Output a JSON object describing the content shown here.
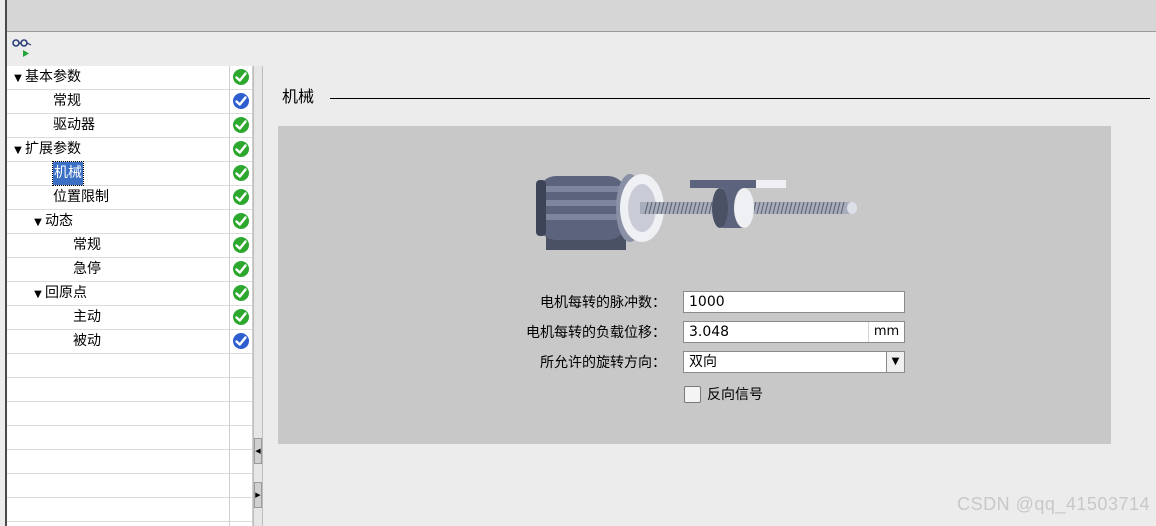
{
  "tree": {
    "items": [
      {
        "label": "基本参数",
        "indent": 0,
        "expanded": true,
        "status": "ok"
      },
      {
        "label": "常规",
        "indent": 1,
        "status": "info"
      },
      {
        "label": "驱动器",
        "indent": 1,
        "status": "ok"
      },
      {
        "label": "扩展参数",
        "indent": 0,
        "expanded": true,
        "status": "ok"
      },
      {
        "label": "机械",
        "indent": 1,
        "status": "ok",
        "selected": true
      },
      {
        "label": "位置限制",
        "indent": 1,
        "status": "ok"
      },
      {
        "label": "动态",
        "indent": 1,
        "expanded": true,
        "status": "ok"
      },
      {
        "label": "常规",
        "indent": 2,
        "status": "ok"
      },
      {
        "label": "急停",
        "indent": 2,
        "status": "ok"
      },
      {
        "label": "回原点",
        "indent": 1,
        "expanded": true,
        "status": "ok"
      },
      {
        "label": "主动",
        "indent": 2,
        "status": "ok"
      },
      {
        "label": "被动",
        "indent": 2,
        "status": "info"
      }
    ]
  },
  "section": {
    "title": "机械"
  },
  "form": {
    "pulses_label": "电机每转的脉冲数：",
    "pulses_value": "1000",
    "load_label": "电机每转的负载位移：",
    "load_value": "3.048",
    "load_unit": "mm",
    "direction_label": "所允许的旋转方向：",
    "direction_value": "双向",
    "invert_label": "反向信号",
    "invert_checked": false
  },
  "watermark": "CSDN @qq_41503714",
  "colors": {
    "ok": "#2fa82f",
    "info": "#2f5fcf",
    "panel": "#c8c8c8"
  },
  "icons": {
    "toolbar": "glasses-play-icon",
    "ok": "check-circle-icon",
    "info": "check-circle-blue-icon"
  }
}
